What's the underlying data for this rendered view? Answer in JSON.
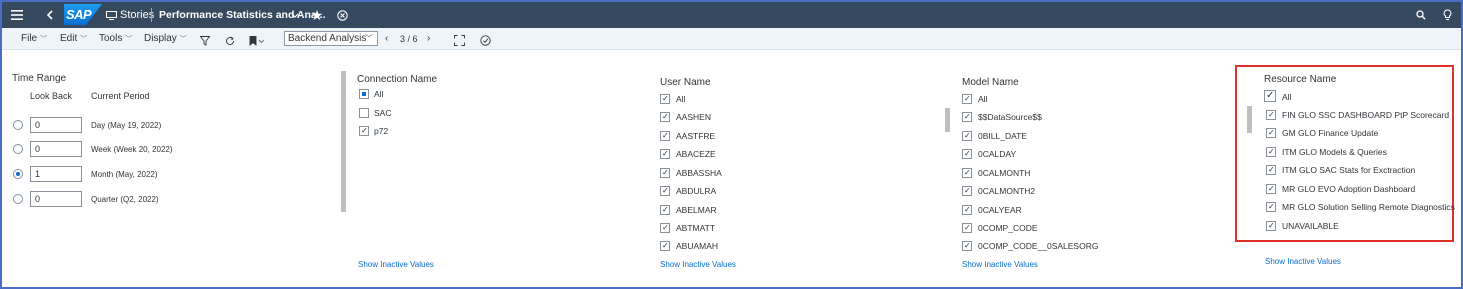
{
  "shell": {
    "brand": "SAP",
    "stories_label": "Stories",
    "story_title": "Performance Statistics and Ana..."
  },
  "toolbar": {
    "file": "File",
    "edit": "Edit",
    "tools": "Tools",
    "display": "Display",
    "page_select": "Backend Analysis",
    "page_indicator": "3 / 6"
  },
  "time_range": {
    "title": "Time Range",
    "col_lookback": "Look Back",
    "col_current": "Current Period",
    "rows": [
      {
        "value": "0",
        "label": "Day (May 19, 2022)",
        "selected": false
      },
      {
        "value": "0",
        "label": "Week (Week 20, 2022)",
        "selected": false
      },
      {
        "value": "1",
        "label": "Month (May, 2022)",
        "selected": true
      },
      {
        "value": "0",
        "label": "Quarter (Q2, 2022)",
        "selected": false
      }
    ]
  },
  "connection": {
    "title": "Connection Name",
    "items": [
      "All",
      "SAC",
      "p72"
    ],
    "show_inactive": "Show Inactive Values"
  },
  "user": {
    "title": "User Name",
    "items": [
      "All",
      "AASHEN",
      "AASTFRE",
      "ABACEZE",
      "ABBASSHA",
      "ABDULRA",
      "ABELMAR",
      "ABTMATT",
      "ABUAMAH"
    ],
    "show_inactive": "Show Inactive Values"
  },
  "model": {
    "title": "Model Name",
    "items": [
      "All",
      "$$DataSource$$",
      "0BILL_DATE",
      "0CALDAY",
      "0CALMONTH",
      "0CALMONTH2",
      "0CALYEAR",
      "0COMP_CODE",
      "0COMP_CODE__0SALESORG"
    ],
    "show_inactive": "Show Inactive Values"
  },
  "resource": {
    "title": "Resource Name",
    "items": [
      "All",
      "FIN GLO SSC DASHBOARD PtP Scorecard",
      "GM GLO Finance Update",
      "ITM GLO Models & Queries",
      "ITM GLO SAC Stats for Exctraction",
      "MR GLO EVO Adoption Dashboard",
      "MR GLO Solution Selling Remote Diagnostics",
      "UNAVAILABLE"
    ],
    "show_inactive": "Show Inactive Values"
  },
  "colors": {
    "shell_bg": "#354a5f",
    "toolbar_bg": "#eff4f9",
    "link": "#0a6ed1",
    "highlight": "#e0312b"
  }
}
